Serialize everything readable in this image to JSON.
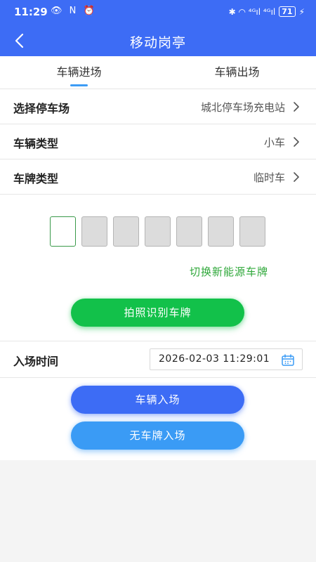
{
  "status_bar": {
    "time": "11:29",
    "left_icons": "👁 N ⏰",
    "right_icons": "✱ ◠ ⁴ᴳıl ⁴ᴳıl",
    "battery": "71",
    "charging": "⚡"
  },
  "header": {
    "title": "移动岗亭",
    "back_icon": "chevron-left-icon"
  },
  "tabs": [
    {
      "label": "车辆进场",
      "active": true
    },
    {
      "label": "车辆出场",
      "active": false
    }
  ],
  "fields": {
    "parking_lot": {
      "label": "选择停车场",
      "value": "城北停车场充电站"
    },
    "vehicle_type": {
      "label": "车辆类型",
      "value": "小车"
    },
    "plate_type": {
      "label": "车牌类型",
      "value": "临时车"
    }
  },
  "plate_switch": "切换新能源车牌",
  "buttons": {
    "photo_recognize": "拍照识别车牌",
    "vehicle_entry": "车辆入场",
    "no_plate_entry": "无车牌入场"
  },
  "entry_time": {
    "label": "入场时间",
    "value": "2026-02-03 11:29:01",
    "icon": "calendar-icon"
  },
  "colors": {
    "primary": "#3d6cf5",
    "green": "#12c14a",
    "light_blue": "#3a9bf5",
    "switch_text": "#2fa83a"
  }
}
